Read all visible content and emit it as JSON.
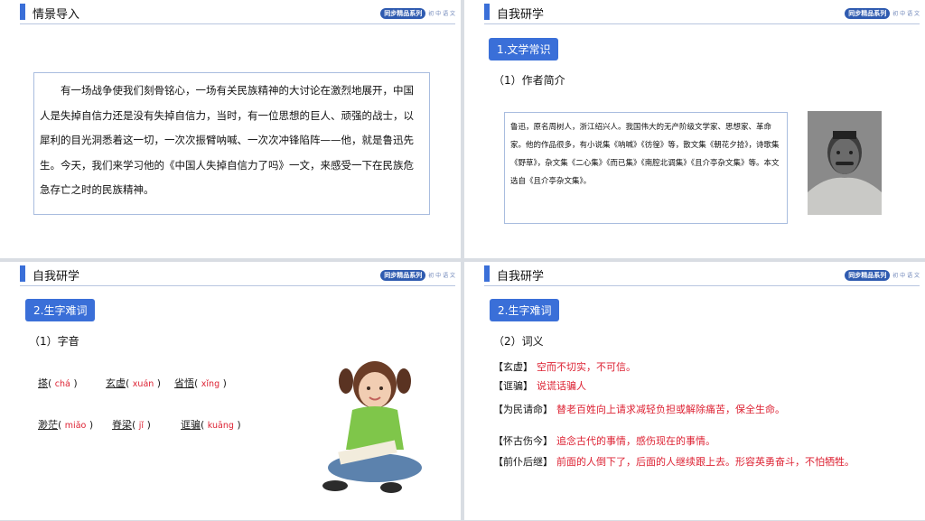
{
  "series": {
    "badge": "同步精品系列",
    "sub": "初 中 语 文"
  },
  "slide1": {
    "title": "情景导入",
    "text": "有一场战争使我们刻骨铭心，一场有关民族精神的大讨论在激烈地展开，中国人是失掉自信力还是没有失掉自信力，当时，有一位思想的巨人、顽强的战士，以犀利的目光洞悉着这一切，一次次振臂呐喊、一次次冲锋陷阵——他，就是鲁迅先生。今天，我们来学习他的《中国人失掉自信力了吗》一文，来感受一下在民族危急存亡之时的民族精神。"
  },
  "slide2": {
    "title": "自我研学",
    "tag": "1.文学常识",
    "subhead": "（1）作者简介",
    "info": "鲁迅，原名周树人，浙江绍兴人。我国伟大的无产阶级文学家、思想家、革命家。他的作品很多，有小说集《呐喊》《彷徨》等，散文集《朝花夕拾》，诗歌集《野草》，杂文集《二心集》《而已集》《南腔北调集》《且介亭杂文集》等。本文选自《且介亭杂文集》。"
  },
  "slide3": {
    "title": "自我研学",
    "tag": "2.生字难词",
    "subhead": "（1）字音",
    "items": [
      {
        "word": "搽",
        "pinyin": "chá"
      },
      {
        "word": "玄虚",
        "pinyin": "xuán"
      },
      {
        "word": "省悟",
        "pinyin": "xǐng"
      },
      {
        "word": "渺茫",
        "pinyin": "miǎo"
      },
      {
        "word": "脊梁",
        "pinyin": "jǐ"
      },
      {
        "word": "诓骗",
        "pinyin": "kuāng"
      }
    ]
  },
  "slide4": {
    "title": "自我研学",
    "tag": "2.生字难词",
    "subhead": "（2）词义",
    "defs": [
      {
        "term": "【玄虚】",
        "text": "空而不切实，不可信。"
      },
      {
        "term": "【诓骗】",
        "text": "说谎话骗人"
      },
      {
        "term": "【为民请命】",
        "text": "替老百姓向上请求减轻负担或解除痛苦，保全生命。"
      },
      {
        "term": "【怀古伤今】",
        "text": "追念古代的事情，感伤现在的事情。"
      },
      {
        "term": "【前仆后继】",
        "text": "前面的人倒下了，后面的人继续跟上去。形容英勇奋斗，不怕牺牲。"
      }
    ]
  }
}
